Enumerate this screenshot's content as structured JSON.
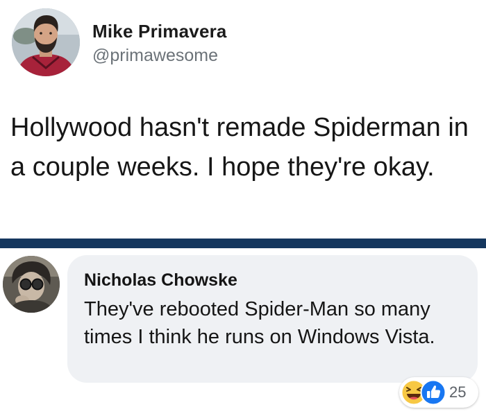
{
  "tweet": {
    "author_name": "Mike Primavera",
    "handle": "@primawesome",
    "text": "Hollywood hasn't remade Spiderman in a couple weeks. I hope they're okay.",
    "avatar_icon": "profile-photo"
  },
  "comment": {
    "author_name": "Nicholas Chowske",
    "text": "They've rebooted Spider-Man so many times I think he runs on Windows Vista.",
    "avatar_icon": "profile-photo",
    "reactions": {
      "icons": [
        "haha-reaction-icon",
        "like-reaction-icon"
      ],
      "count": "25"
    }
  },
  "colors": {
    "divider": "#15375e",
    "bubble": "#eff1f4",
    "like_blue": "#1877f2",
    "haha_yellow": "#f7c844"
  }
}
